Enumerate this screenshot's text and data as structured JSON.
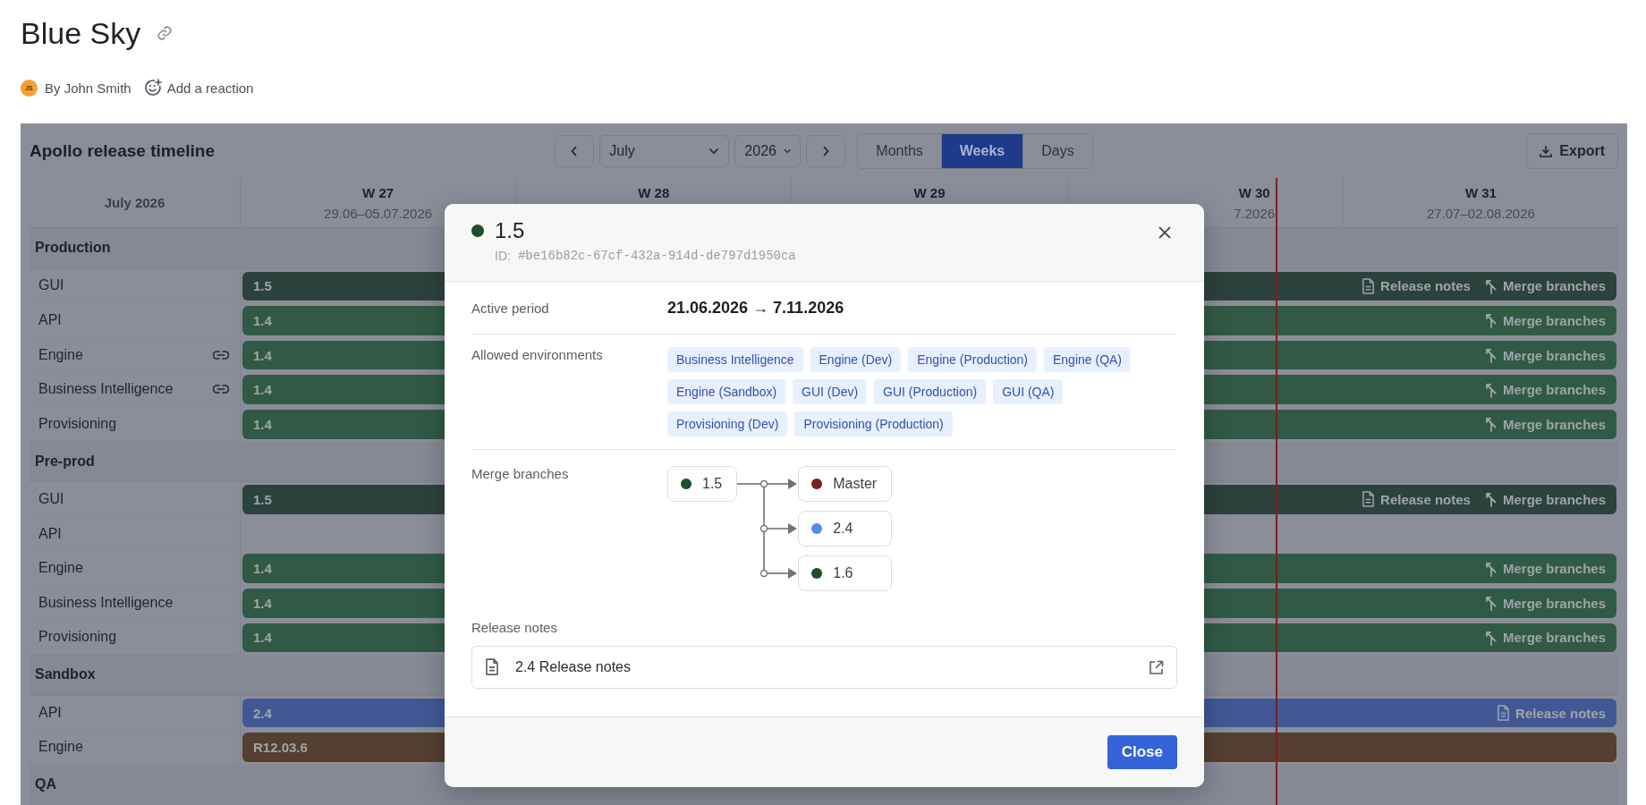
{
  "page": {
    "title": "Blue Sky",
    "author_initials": "JS",
    "byline": "By John Smith",
    "reaction": "Add a reaction"
  },
  "timeline": {
    "title": "Apollo release timeline",
    "month": "July",
    "year": "2026",
    "views": [
      {
        "label": "Months",
        "selected": false
      },
      {
        "label": "Weeks",
        "selected": true
      },
      {
        "label": "Days",
        "selected": false
      }
    ],
    "export": "Export",
    "period_label": "July 2026",
    "weeks": [
      {
        "label": "W 27",
        "dates": "29.06–05.07.2026"
      },
      {
        "label": "W 28"
      },
      {
        "label": "W 29"
      },
      {
        "label": "W 30",
        "dates": "7.2026"
      },
      {
        "label": "W 31",
        "dates": "27.07–02.08.2026"
      }
    ],
    "groups": [
      {
        "name": "Production",
        "rows": [
          {
            "name": "GUI",
            "linked": false,
            "bar": {
              "label": "1.5",
              "color": "#2c423d",
              "actions": [
                {
                  "kind": "notes",
                  "label": "Release notes"
                },
                {
                  "kind": "merge",
                  "label": "Merge branches"
                }
              ]
            }
          },
          {
            "name": "API",
            "linked": false,
            "bar": {
              "label": "1.4",
              "color": "#305a45",
              "actions": [
                {
                  "kind": "merge",
                  "label": "Merge branches"
                }
              ]
            }
          },
          {
            "name": "Engine",
            "linked": true,
            "bar": {
              "label": "1.4",
              "color": "#305a45",
              "actions": [
                {
                  "kind": "merge",
                  "label": "Merge branches"
                }
              ]
            }
          },
          {
            "name": "Business Intelligence",
            "linked": true,
            "bar": {
              "label": "1.4",
              "color": "#305a45",
              "actions": [
                {
                  "kind": "merge",
                  "label": "Merge branches"
                }
              ]
            }
          },
          {
            "name": "Provisioning",
            "linked": false,
            "bar": {
              "label": "1.4",
              "color": "#305a45",
              "actions": [
                {
                  "kind": "merge",
                  "label": "Merge branches"
                }
              ]
            }
          }
        ]
      },
      {
        "name": "Pre-prod",
        "rows": [
          {
            "name": "GUI",
            "linked": false,
            "bar": {
              "label": "1.5",
              "color": "#2c423d",
              "actions": [
                {
                  "kind": "notes",
                  "label": "Release notes"
                },
                {
                  "kind": "merge",
                  "label": "Merge branches"
                }
              ]
            }
          },
          {
            "name": "API",
            "linked": false
          },
          {
            "name": "Engine",
            "linked": false,
            "bar": {
              "label": "1.4",
              "color": "#305a45",
              "actions": [
                {
                  "kind": "merge",
                  "label": "Merge branches"
                }
              ]
            }
          },
          {
            "name": "Business Intelligence",
            "linked": false,
            "bar": {
              "label": "1.4",
              "color": "#305a45",
              "actions": [
                {
                  "kind": "merge",
                  "label": "Merge branches"
                }
              ]
            }
          },
          {
            "name": "Provisioning",
            "linked": false,
            "bar": {
              "label": "1.4",
              "color": "#305a45",
              "actions": [
                {
                  "kind": "merge",
                  "label": "Merge branches"
                }
              ]
            }
          }
        ]
      },
      {
        "name": "Sandbox",
        "rows": [
          {
            "name": "API",
            "linked": false,
            "bar": {
              "label": "2.4",
              "color": "#415895",
              "actions": [
                {
                  "kind": "notes",
                  "label": "Release notes"
                }
              ]
            }
          },
          {
            "name": "Engine",
            "linked": false,
            "bar": {
              "label": "R12.03.6",
              "color": "#543f30"
            }
          }
        ]
      },
      {
        "name": "QA"
      }
    ]
  },
  "modal": {
    "title": "1.5",
    "color": "#1e4d2b",
    "id_label": "ID:",
    "id": "#be16b82c-67cf-432a-914d-de797d1950ca",
    "active_period": {
      "label": "Active period",
      "value": "21.06.2026 → 7.11.2026"
    },
    "environments": {
      "label": "Allowed environments",
      "tags": [
        "Business Intelligence",
        "Engine (Dev)",
        "Engine (Production)",
        "Engine (QA)",
        "Engine (Sandbox)",
        "GUI (Dev)",
        "GUI (Production)",
        "GUI (QA)",
        "Provisioning (Dev)",
        "Provisioning (Production)"
      ]
    },
    "merge": {
      "label": "Merge branches",
      "source": {
        "name": "1.5",
        "color": "#1e4d2b"
      },
      "targets": [
        {
          "name": "Master",
          "color": "#7a1f1f"
        },
        {
          "name": "2.4",
          "color": "#5b86f0"
        },
        {
          "name": "1.6",
          "color": "#1e4d2b"
        }
      ]
    },
    "release_notes": {
      "label": "Release notes",
      "items": [
        {
          "title": "2.4 Release notes"
        }
      ]
    },
    "close": "Close"
  }
}
